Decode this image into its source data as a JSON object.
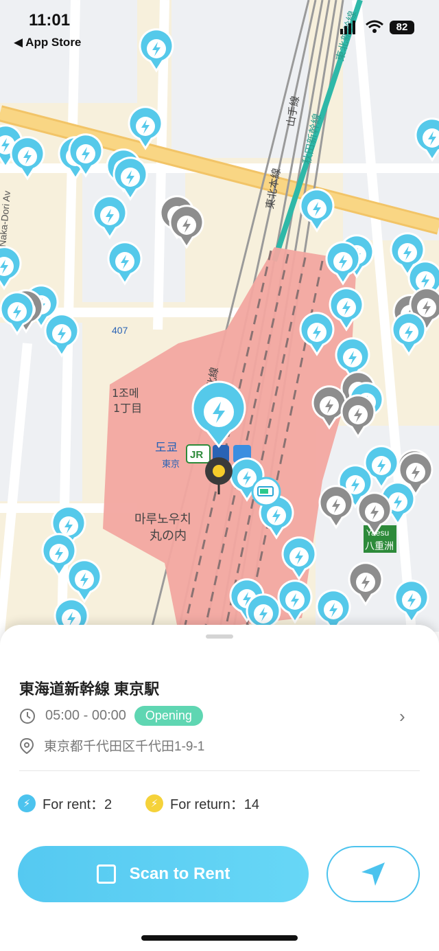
{
  "status_bar": {
    "time": "11:01",
    "back_app": "◀ App Store",
    "battery": "82"
  },
  "map": {
    "labels": {
      "road_407": "407",
      "chome_ko": "1조메",
      "chome_jp": "1丁目",
      "tokyo_ko": "도쿄",
      "tokyo_jp": "東京",
      "marunouchi_ko": "마루노우치",
      "marunouchi_jp": "丸の内",
      "yaesu_jp": "八重洲",
      "yaesu_en": "Yaesu",
      "tohoku_line": "東北本線",
      "yamanote": "山手線",
      "akita": "秋田新幹線",
      "tohoku": "東北線",
      "tohoku_shinkansen": "東北新幹線",
      "nakadori": "Naka-Dori Av",
      "jr": "JR"
    }
  },
  "station": {
    "name": "東海道新幹線 東京駅",
    "hours": "05:00 - 00:00",
    "status": "Opening",
    "address": "東京都千代田区千代田1-9-1",
    "rent_label": "For rent：2",
    "return_label": "For return：14"
  },
  "actions": {
    "scan_label": "Scan to Rent"
  },
  "colors": {
    "accent": "#4cc3ee",
    "pin_active": "#55c9ea",
    "pin_inactive": "#8d8d8d",
    "station_area": "#f2a6a0",
    "open_badge": "#5fd6b2"
  }
}
